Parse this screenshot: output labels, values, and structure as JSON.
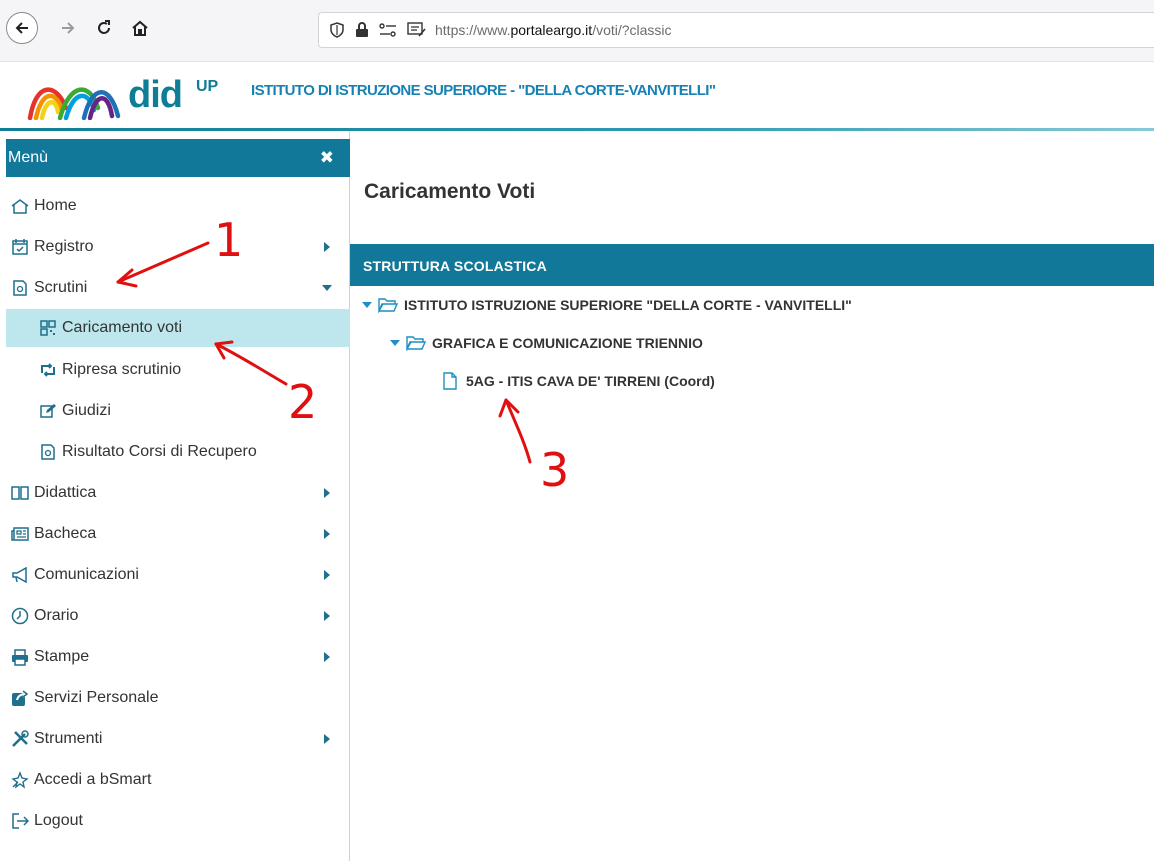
{
  "browser": {
    "url_prefix": "https://www.",
    "url_host": "portaleargo.it",
    "url_path": "/voti/?classic"
  },
  "header": {
    "logo_word": "did",
    "logo_sup": "UP",
    "school_name": "ISTITUTO DI ISTRUZIONE SUPERIORE - \"DELLA CORTE-VANVITELLI\""
  },
  "sidebar": {
    "title": "Menù",
    "close_glyph": "✖",
    "items": [
      {
        "label": "Home",
        "icon": "home-icon"
      },
      {
        "label": "Registro",
        "icon": "calendar-check-icon"
      },
      {
        "label": "Scrutini",
        "icon": "scrutini-icon"
      },
      {
        "label": "Caricamento voti",
        "icon": "qrcode-icon"
      },
      {
        "label": "Ripresa scrutinio",
        "icon": "retweet-icon"
      },
      {
        "label": "Giudizi",
        "icon": "edit-icon"
      },
      {
        "label": "Risultato Corsi di Recupero",
        "icon": "scrutini-icon"
      },
      {
        "label": "Didattica",
        "icon": "book-icon"
      },
      {
        "label": "Bacheca",
        "icon": "newspaper-icon"
      },
      {
        "label": "Comunicazioni",
        "icon": "megaphone-icon"
      },
      {
        "label": "Orario",
        "icon": "clock-icon"
      },
      {
        "label": "Stampe",
        "icon": "printer-icon"
      },
      {
        "label": "Servizi Personale",
        "icon": "share-icon"
      },
      {
        "label": "Strumenti",
        "icon": "tools-icon"
      },
      {
        "label": "Accedi a bSmart",
        "icon": "bsmart-icon"
      },
      {
        "label": "Logout",
        "icon": "logout-icon"
      }
    ]
  },
  "main": {
    "title": "Caricamento Voti",
    "section_title": "STRUTTURA SCOLASTICA",
    "tree": [
      {
        "label": "ISTITUTO ISTRUZIONE SUPERIORE \"DELLA CORTE - VANVITELLI\"",
        "type": "folder",
        "expanded": true
      },
      {
        "label": "GRAFICA E COMUNICAZIONE TRIENNIO",
        "type": "folder",
        "expanded": true
      },
      {
        "label": "5AG - ITIS CAVA DE' TIRRENI (Coord)",
        "type": "file"
      }
    ]
  },
  "annotations": {
    "label_1": "1",
    "label_2": "2",
    "label_3": "3",
    "color": "#e01010"
  },
  "colors": {
    "brand": "#127899",
    "active_item_bg": "#bde7ec",
    "icon_blue": "#1f6f8d"
  }
}
